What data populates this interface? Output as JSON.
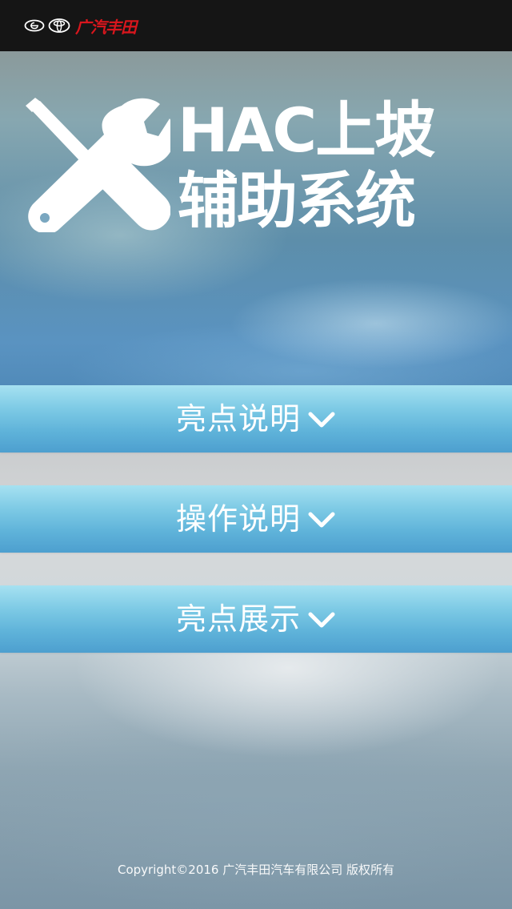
{
  "header": {
    "brand_name": "广汽丰田",
    "brand_color": "#d8161d",
    "icons": [
      "gac-emblem-icon",
      "toyota-emblem-icon"
    ]
  },
  "hero": {
    "title_line1": "HAC上坡",
    "title_line2": "辅助系统",
    "icon": "wrench-screwdriver-icon"
  },
  "menu": {
    "items": [
      {
        "label": "亮点说明",
        "icon": "chevron-down-icon"
      },
      {
        "label": "操作说明",
        "icon": "chevron-down-icon"
      },
      {
        "label": "亮点展示",
        "icon": "chevron-down-icon"
      }
    ],
    "accent_color": "#7dcae5"
  },
  "footer": {
    "copyright": "Copyright©2016 广汽丰田汽车有限公司 版权所有"
  }
}
